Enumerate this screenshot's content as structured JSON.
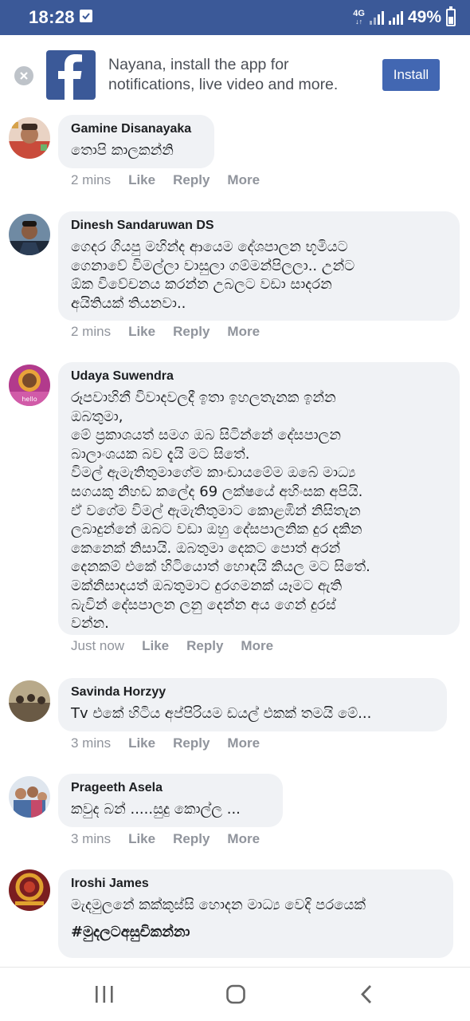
{
  "status_bar": {
    "time": "18:28",
    "network": "4G",
    "battery": "49%"
  },
  "banner": {
    "message": "Nayana, install the app for notifications, live video and more.",
    "install_label": "Install",
    "brand_color": "#3b5998",
    "button_color": "#4267b2"
  },
  "actions": {
    "like": "Like",
    "reply": "Reply",
    "more": "More"
  },
  "comments": [
    {
      "author": "Gamine Disanayaka",
      "text": "තොපි කාලකන්නි",
      "time": "2 mins",
      "avatar_icon": "user-photo-icon"
    },
    {
      "author": "Dinesh Sandaruwan DS",
      "text": "ගෙදර ගියපු මහින්ද ආයෙම දේශපාලන භූමියට\nගෙනාවේ විමල්ලා වාසුලා ගම්මන්පිලලා.. උන්ට\nඕක විවේචනය කරන්න උබලට වඩා සාදරන\nඅයිතියක් තියනවා..",
      "time": "2 mins",
      "avatar_icon": "user-photo-icon"
    },
    {
      "author": "Udaya Suwendra",
      "text": "රූපවාහිනී විවාදවලදී ඉතා ඉහලතැනක ඉන්න\nඔබතුමා,\nමේ ප්‍රකාශයත් සමග ඔබ සිටින්නේ දේසපාලන\nබාලාංශයක බව දැයි මට සිතේ.\nවිමල් ඇමැතිතුමාගේම කාංඩායමේම ඔබේ මාධ්‍ය\nසගයකු නිහඩ කලේද 69 ලක්ෂයේ අහිංසක අපියි.\nඒ වගේම විමල් ඇමැතිතුමාට කොළඹින් නිසිතැන\nලබාදුන්නේ ඔබට වඩා ඔහු දේසපාලනික දුර දකින\nකෙනෙක් නිසායි. ඔබතුමා දෙකට පොත් අරන්\nදෙනකම් එකේ හිටියොත් හොඳයි කියල මට සිතේ.\nමක්නිසාදයත් ඔබතුමාට දුරගමනක් යෑමට ඇති\nබැවින් දේසපාලන ලනු දෙන්න අය ගෙන් දුරස්\nවන්න.",
      "time": "Just now",
      "avatar_icon": "user-photo-icon"
    },
    {
      "author": "Savinda Horzyy",
      "text": "Tv එකේ හිටිය අප්පිරියම ඩයල් එකක් තමයි මේ...",
      "time": "3 mins",
      "avatar_icon": "user-photo-icon"
    },
    {
      "author": "Prageeth Asela",
      "text": "කවුද බන් .....සුදු කොල්ල ...",
      "time": "3 mins",
      "avatar_icon": "user-photo-icon"
    },
    {
      "author": "Iroshi James",
      "text": "මැදමුලනේ කක්කුස්සි හොදන මාධ්‍ය වෙදි පරයෙක්",
      "hashtag": "#මුදලටඅසුචිකන්නා",
      "avatar_icon": "user-photo-icon"
    }
  ]
}
